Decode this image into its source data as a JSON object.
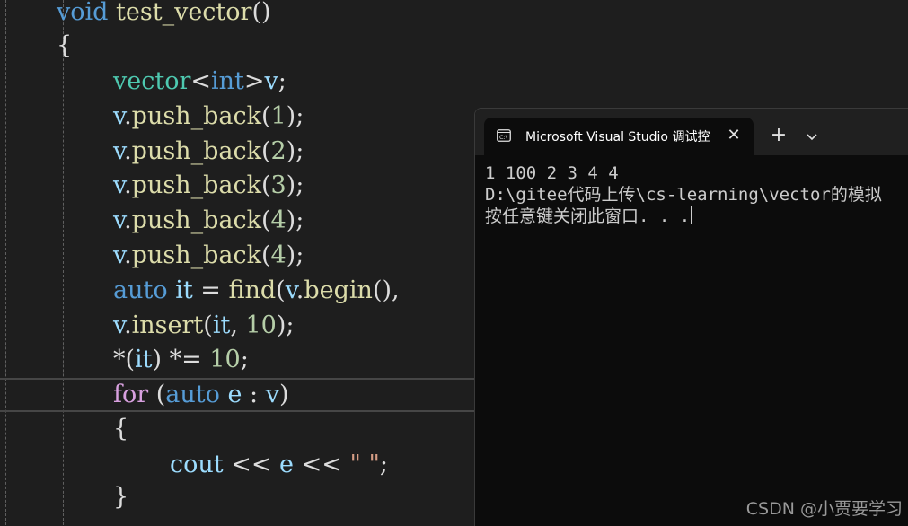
{
  "code": {
    "line1": {
      "kw": "void",
      "fn": "test_vector",
      "punct": "()"
    },
    "line2": {
      "punct": "{"
    },
    "line3": {
      "type": "vector",
      "lt": "<",
      "kw": "int",
      "gt": ">",
      "var": "v",
      "semi": ";"
    },
    "push_back_lines": [
      {
        "var": "v",
        "dot": ".",
        "fn": "push_back",
        "open": "(",
        "num": "1",
        "close": ");"
      },
      {
        "var": "v",
        "dot": ".",
        "fn": "push_back",
        "open": "(",
        "num": "2",
        "close": ");"
      },
      {
        "var": "v",
        "dot": ".",
        "fn": "push_back",
        "open": "(",
        "num": "3",
        "close": ");"
      },
      {
        "var": "v",
        "dot": ".",
        "fn": "push_back",
        "open": "(",
        "num": "4",
        "close": ");"
      },
      {
        "var": "v",
        "dot": ".",
        "fn": "push_back",
        "open": "(",
        "num": "4",
        "close": ");"
      }
    ],
    "line9": {
      "kw": "auto",
      "var1": "it",
      "eq": " = ",
      "fn": "find",
      "open": "(",
      "var2": "v",
      "dot": ".",
      "fn2": "begin",
      "tail": "(),"
    },
    "line10": {
      "var": "v",
      "dot": ".",
      "fn": "insert",
      "open": "(",
      "var2": "it",
      "comma": ", ",
      "num": "10",
      "close": ");"
    },
    "line11": {
      "star": "*(",
      "var": "it",
      "op": ") *= ",
      "num": "10",
      "semi": ";"
    },
    "line12": {
      "ctrl": "for",
      "open": " (",
      "kw": "auto",
      "var": "e",
      "colon": " : ",
      "var2": "v",
      "close": ")"
    },
    "line13": {
      "punct": "{"
    },
    "line14": {
      "var": "cout",
      "op": " << ",
      "var2": "e",
      "op2": " << ",
      "str": "\" \"",
      "semi": ";"
    },
    "line15": {
      "punct": "}"
    }
  },
  "terminal": {
    "tab_title": "Microsoft Visual Studio 调试控",
    "close_glyph": "✕",
    "new_tab_glyph": "+",
    "output": [
      "1 100 2 3 4 4",
      "D:\\gitee代码上传\\cs-learning\\vector的模拟",
      "按任意键关闭此窗口. . ."
    ]
  },
  "watermark": "CSDN @小贾要学习"
}
